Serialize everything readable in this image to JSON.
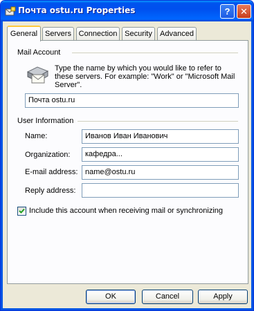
{
  "window": {
    "title": "Почта ostu.ru Properties",
    "help_glyph": "?",
    "close_glyph": "✕"
  },
  "tabs": [
    {
      "label": "General",
      "active": true
    },
    {
      "label": "Servers",
      "active": false
    },
    {
      "label": "Connection",
      "active": false
    },
    {
      "label": "Security",
      "active": false
    },
    {
      "label": "Advanced",
      "active": false
    }
  ],
  "mail_account": {
    "group_label": "Mail Account",
    "description": "Type the name by which you would like to refer to these servers.  For example: \"Work\" or \"Microsoft Mail Server\".",
    "account_name": "Почта ostu.ru",
    "icon": "mail-account-icon"
  },
  "user_information": {
    "group_label": "User Information",
    "name_label": "Name:",
    "name_value": "Иванов Иван Иванович",
    "organization_label": "Organization:",
    "organization_value": "кафедра...",
    "email_label": "E-mail address:",
    "email_value": "name@ostu.ru",
    "reply_label": "Reply address:",
    "reply_value": ""
  },
  "include_account": {
    "label": "Include this account when receiving mail or synchronizing",
    "checked": true
  },
  "buttons": {
    "ok": "OK",
    "cancel": "Cancel",
    "apply": "Apply"
  },
  "colors": {
    "titlebar": "#0054e3",
    "dialog_bg": "#ece9d8",
    "tab_highlight": "#ffc83c",
    "input_border": "#7f9db9",
    "checkmark": "#21a121"
  }
}
